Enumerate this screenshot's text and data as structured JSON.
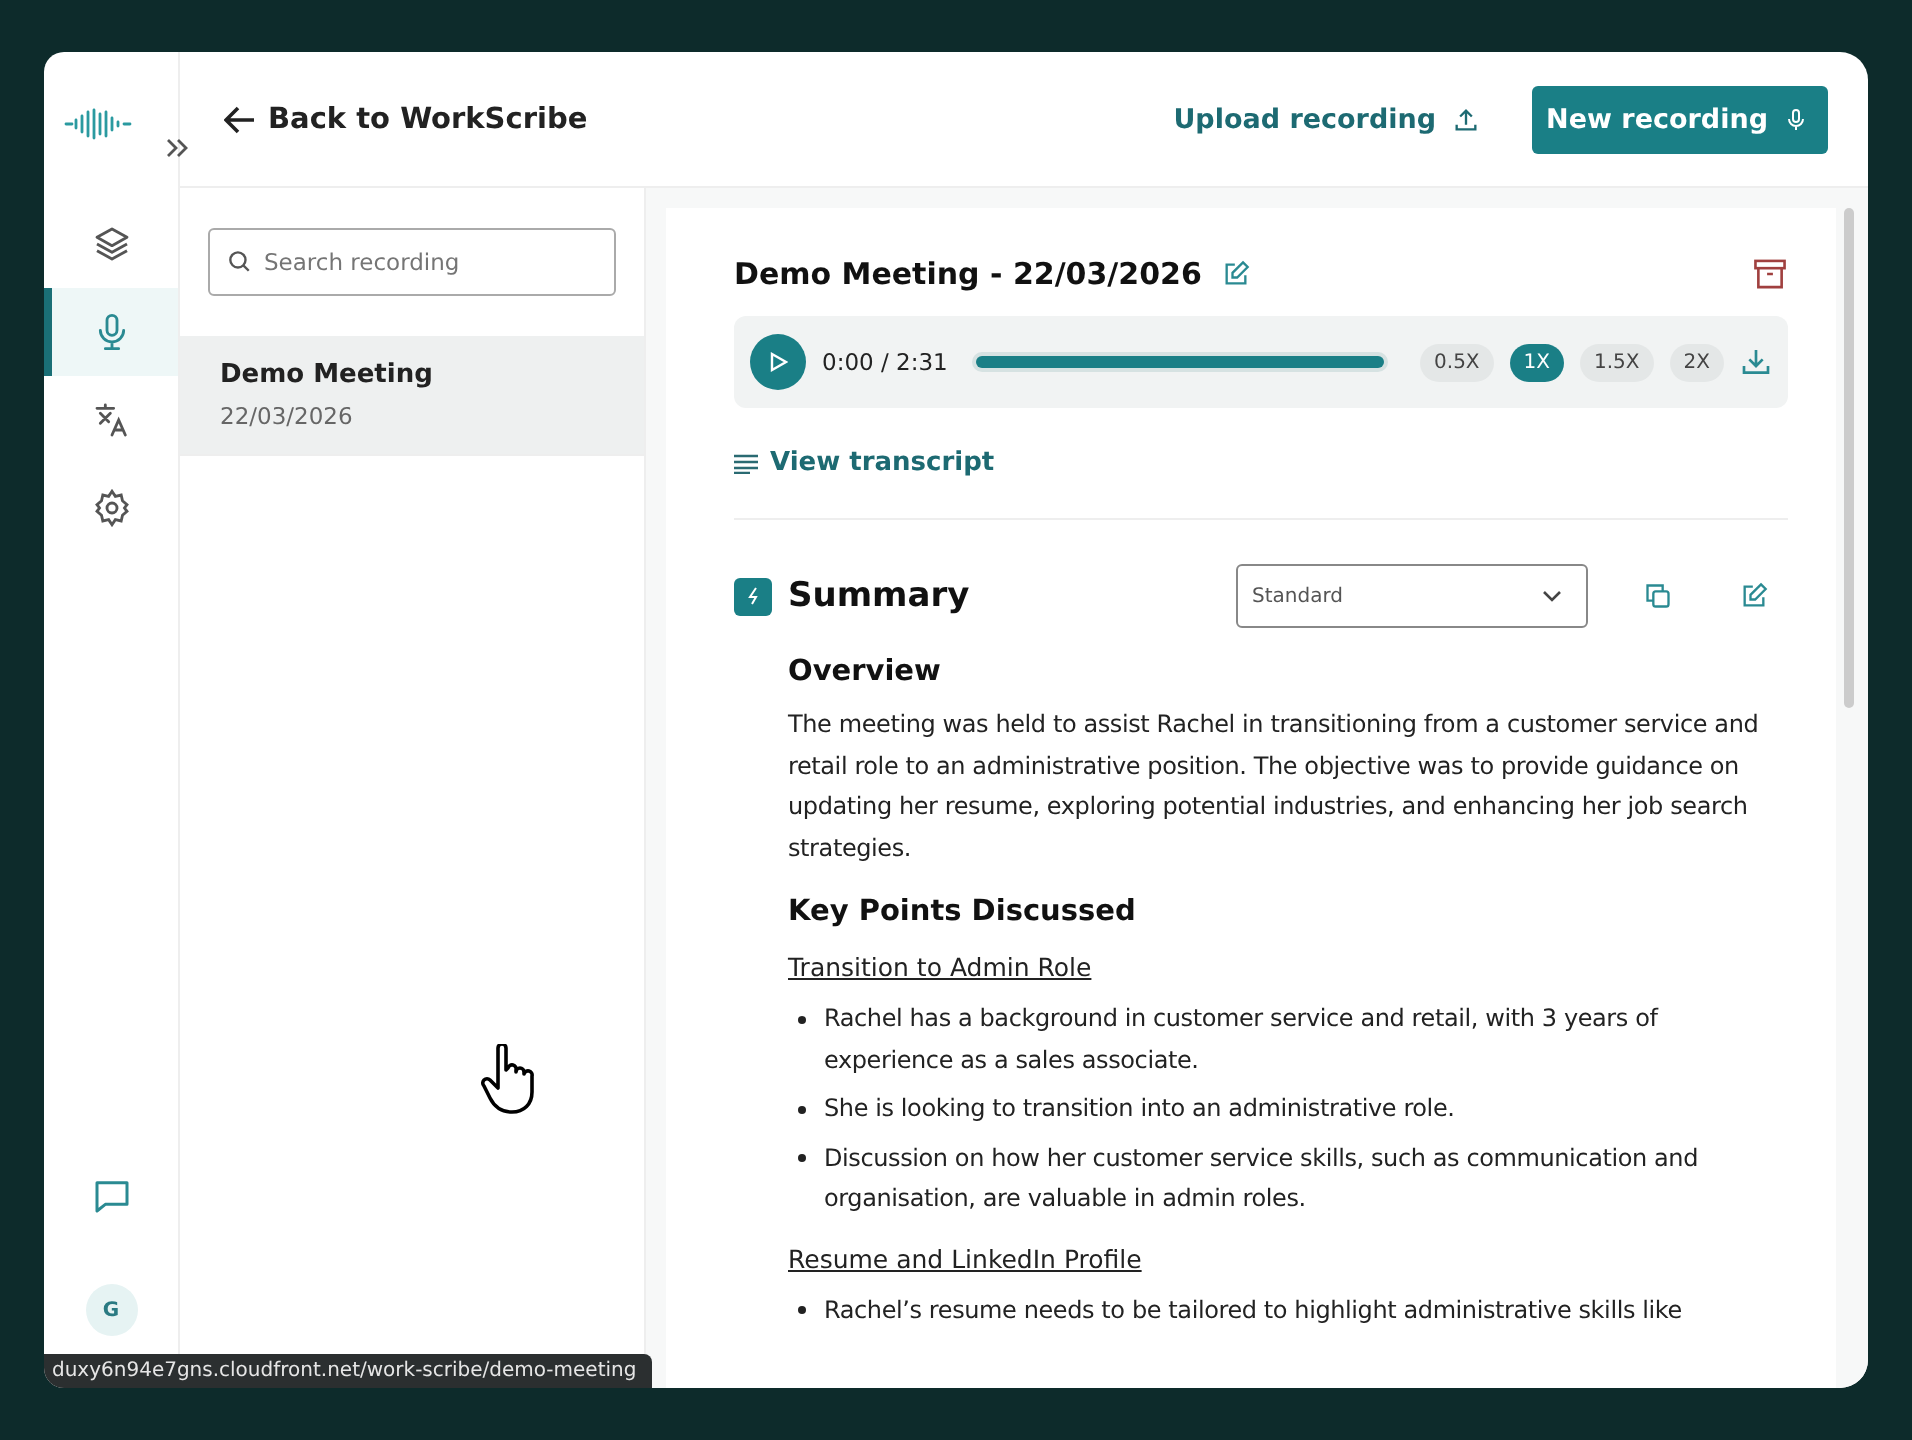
{
  "rail": {
    "nav": [
      {
        "kind": "layers",
        "selected": false
      },
      {
        "kind": "mic",
        "selected": true
      },
      {
        "kind": "translate",
        "selected": false
      },
      {
        "kind": "settings",
        "selected": false
      }
    ],
    "avatar": "G"
  },
  "header": {
    "back": "Back to WorkScribe",
    "upload": "Upload recording",
    "new": "New recording"
  },
  "list": {
    "search": {
      "placeholder": "Search recording"
    },
    "items": [
      {
        "title": "Demo Meeting",
        "date": "22/03/2026",
        "selected": true
      }
    ]
  },
  "recording": {
    "title": "Demo Meeting - 22/03/2026",
    "time": "0:00 / 2:31",
    "level": 1,
    "speeds": [
      {
        "label": "0.5X",
        "selected": false
      },
      {
        "label": "1X",
        "selected": true
      },
      {
        "label": "1.5X",
        "selected": false
      },
      {
        "label": "2X",
        "selected": false
      }
    ],
    "transcript": "View transcript"
  },
  "summary": {
    "title": "Summary",
    "mode": "Standard",
    "overview_heading": "Overview",
    "overview": "The meeting was held to assist Rachel in transitioning from a customer service and retail role to an administrative position. The objective was to provide guidance on updating her resume, exploring potential industries, and enhancing her job search strategies.",
    "key_heading": "Key Points Discussed",
    "sections": [
      {
        "heading": "Transition to Admin Role",
        "bullets": [
          "Rachel has a background in customer service and retail, with 3 years of experience as a sales associate.",
          "She is looking to transition into an administrative role.",
          "Discussion on how her customer service skills, such as communication and organisation, are valuable in admin roles."
        ]
      },
      {
        "heading": "Resume and LinkedIn Profile",
        "bullets": [
          "Rachel’s resume needs to be tailored to highlight administrative skills like"
        ]
      }
    ]
  },
  "status_url": "duxy6n94e7gns.cloudfront.net/work-scribe/demo-meeting"
}
